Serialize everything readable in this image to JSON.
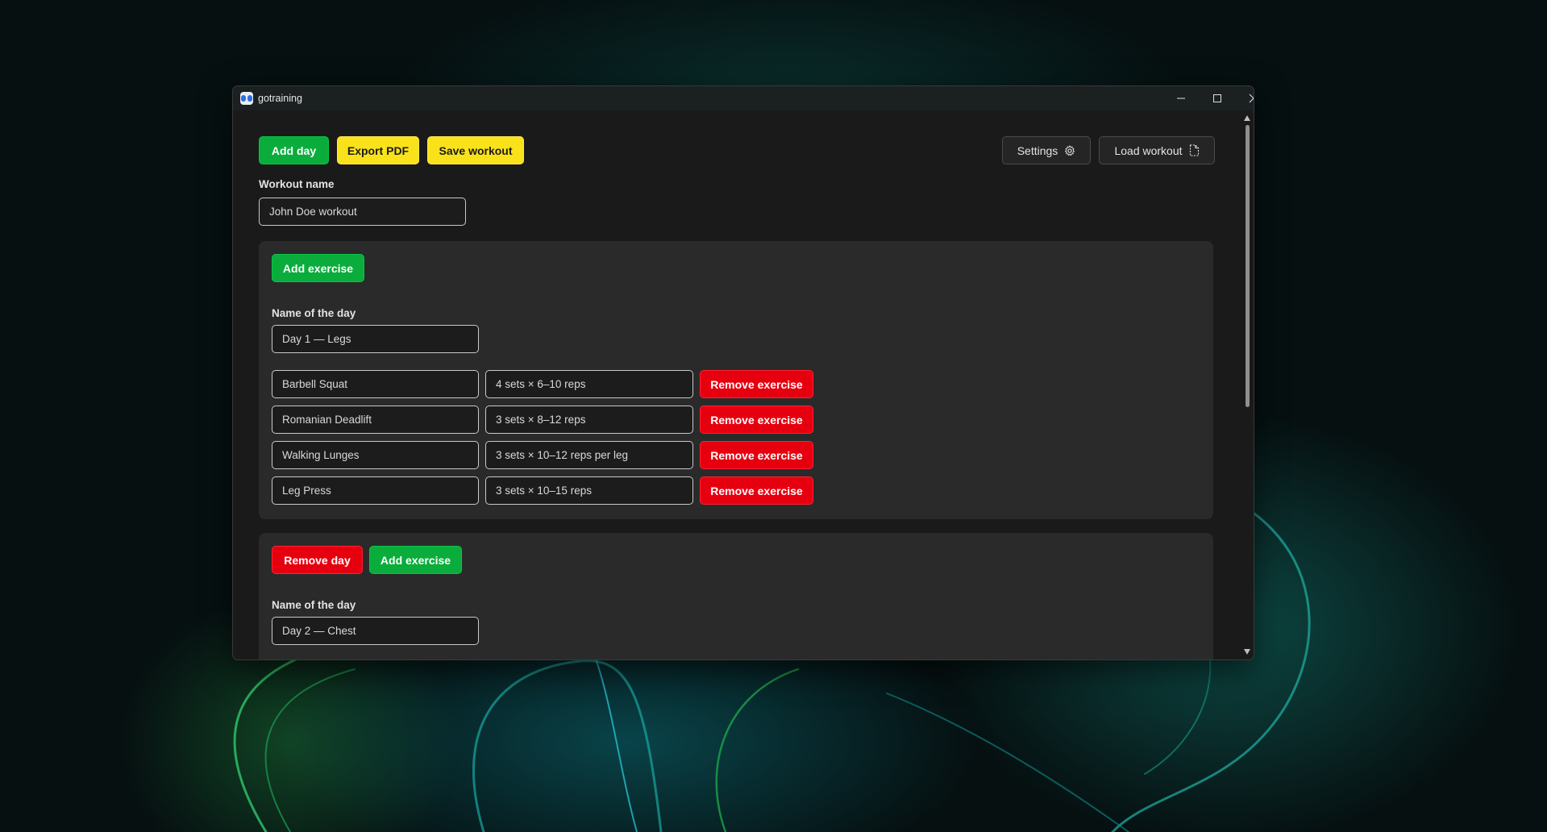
{
  "window": {
    "title": "gotraining"
  },
  "toolbar": {
    "add_day": "Add day",
    "export_pdf": "Export PDF",
    "save_workout": "Save workout",
    "settings": "Settings",
    "load_workout": "Load workout"
  },
  "workout": {
    "label": "Workout name",
    "value": "John Doe workout"
  },
  "days": [
    {
      "add_exercise": "Add exercise",
      "name_label": "Name of the day",
      "name_value": "Day 1 — Legs",
      "exercises": [
        {
          "name": "Barbell Squat",
          "scheme": "4 sets × 6–10 reps",
          "remove": "Remove exercise"
        },
        {
          "name": "Romanian Deadlift",
          "scheme": "3 sets × 8–12 reps",
          "remove": "Remove exercise"
        },
        {
          "name": "Walking Lunges",
          "scheme": "3 sets × 10–12 reps per leg",
          "remove": "Remove exercise"
        },
        {
          "name": "Leg Press",
          "scheme": "3 sets × 10–15 reps",
          "remove": "Remove exercise"
        }
      ]
    },
    {
      "remove_day": "Remove day",
      "add_exercise": "Add exercise",
      "name_label": "Name of the day",
      "name_value": "Day 2 — Chest"
    }
  ],
  "colors": {
    "primary": "#0aad3c",
    "warning": "#f9e21a",
    "danger": "#e6000f",
    "surface": "#2a2a2b",
    "background": "#1a1a1a"
  },
  "icons": {
    "settings": "gear-icon",
    "load": "file-icon",
    "app": "app-icon"
  }
}
